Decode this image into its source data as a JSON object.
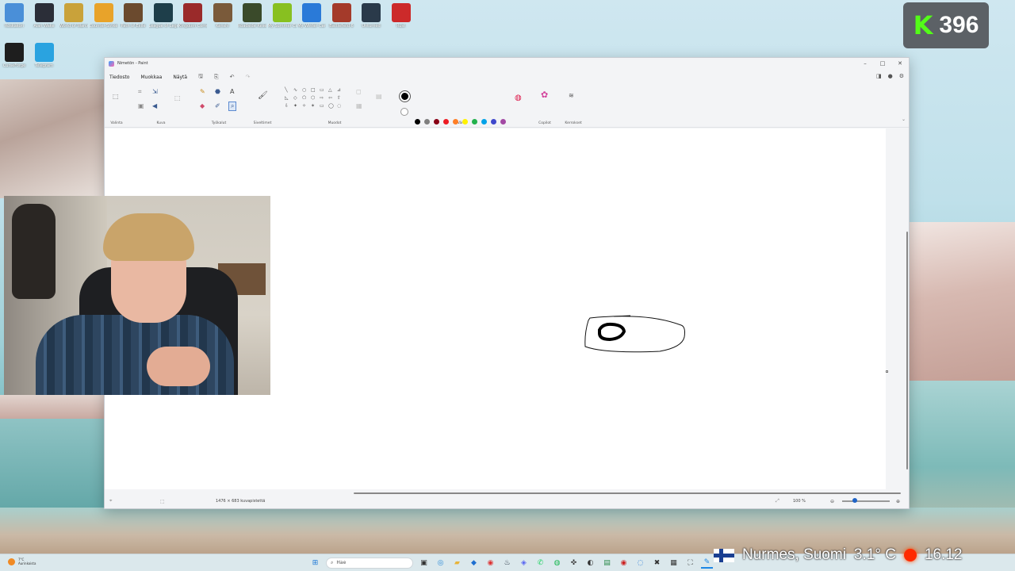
{
  "desktop": {
    "icons_row1": [
      {
        "label": "Roskakori",
        "color": "#4a8fd8"
      },
      {
        "label": "Alan Wake",
        "color": "#2b2e38"
      },
      {
        "label": "World of Warcraft",
        "color": "#c9a23a"
      },
      {
        "label": "Counter-Strike 2",
        "color": "#e8a32a"
      },
      {
        "label": "Path of Exile",
        "color": "#6b4a2e"
      },
      {
        "label": "League of Legends",
        "color": "#1e3e4a"
      },
      {
        "label": "Kingdom Come",
        "color": "#9a2a2a"
      },
      {
        "label": "Kenshi",
        "color": "#7a5a3a"
      },
      {
        "label": "Roadside Research",
        "color": "#3a4a2a"
      },
      {
        "label": "My Summer Car",
        "color": "#88c020"
      },
      {
        "label": "My Winter Car",
        "color": "#2a7ad8"
      },
      {
        "label": "Battlefield 6",
        "color": "#a43a2a"
      },
      {
        "label": "Unturned",
        "color": "#2a3a4a"
      },
      {
        "label": "Rust",
        "color": "#cc2a2a"
      }
    ],
    "icons_row2": [
      {
        "label": "CurseForge",
        "color": "#1e1e1e"
      },
      {
        "label": "Telegram",
        "color": "#2aa3e0"
      }
    ]
  },
  "badge": {
    "letter": "K",
    "count": "396"
  },
  "paint": {
    "title": "Nimetön - Paint",
    "menu": [
      "Tiedosto",
      "Muokkaa",
      "Näytä"
    ],
    "groups": [
      "Valinta",
      "Kuva",
      "Työkalut",
      "Siveltimet",
      "Muodot",
      "Värit",
      "Copilot",
      "Kerrokset"
    ],
    "colors_row1": [
      "#000000",
      "#7f7f7f",
      "#880015",
      "#ed1c24",
      "#ff7f27",
      "#fff200",
      "#22b14c",
      "#00a2e8",
      "#3f48cc",
      "#a349a4"
    ],
    "colors_row2": [
      "#ffffff",
      "#c3c3c3",
      "#b97a57",
      "#ffaec9",
      "#ffc90e",
      "#efe4b0",
      "#b5e61d",
      "#99d9ea",
      "#7092be",
      "#c8bfe7"
    ],
    "canvas_size": "1476 × 683 kuvapistettä",
    "zoom": "100 %"
  },
  "taskbar": {
    "weather_temp": "7°C",
    "weather_desc": "Aurinkoista",
    "search_placeholder": "Hae",
    "location": "Nurmes, Suomi",
    "temperature": "3.1° C",
    "time": "16.12"
  }
}
